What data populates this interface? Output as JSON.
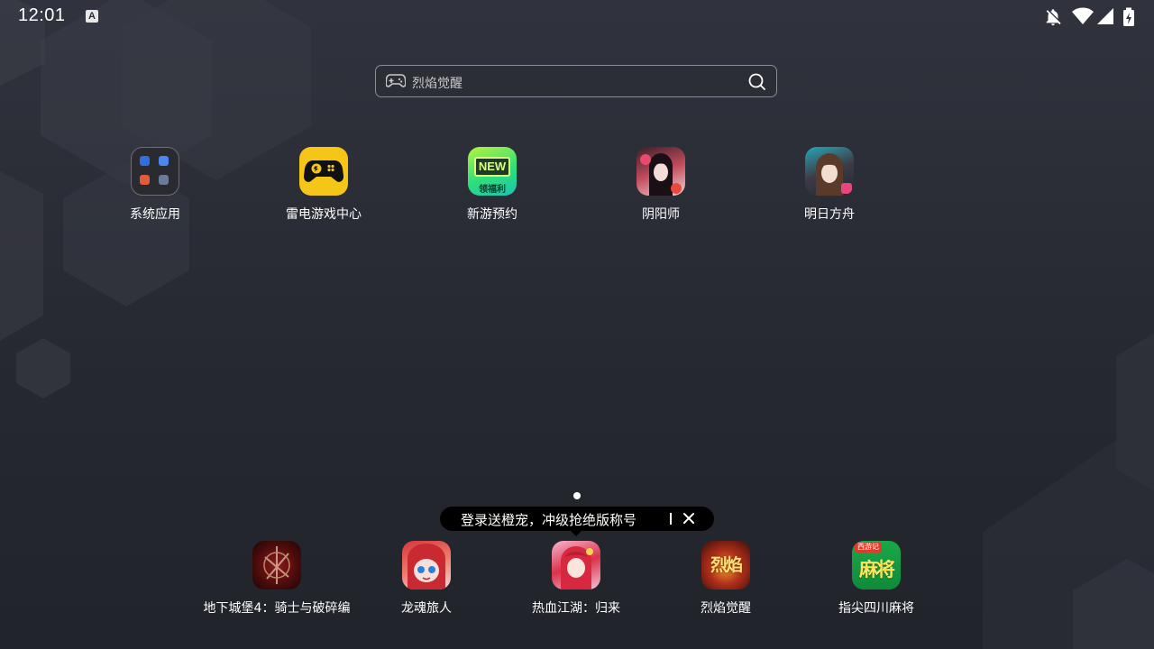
{
  "status_bar": {
    "time": "12:01",
    "notification_badge": "A",
    "icons": [
      "notifications-off-icon",
      "wifi-icon",
      "cell-signal-icon",
      "battery-charging-icon"
    ]
  },
  "search": {
    "hint": "烈焰觉醒",
    "left_icon": "gamepad-icon",
    "right_icon": "search-icon"
  },
  "apps": [
    {
      "label": "系统应用",
      "icon": "folder-icon"
    },
    {
      "label": "雷电游戏中心",
      "icon": "gamepad-icon"
    },
    {
      "label": "新游预约",
      "icon": "new-games-icon",
      "badge_top": "NEW",
      "badge_bottom": "领福利"
    },
    {
      "label": "阴阳师",
      "icon": "onmyoji-icon"
    },
    {
      "label": "明日方舟",
      "icon": "arknights-icon"
    }
  ],
  "page_indicator": {
    "current": 1,
    "total": 1
  },
  "promo": {
    "text": "登录送橙宠，冲级抢绝版称号",
    "close_icon": "close-icon"
  },
  "dock": [
    {
      "label": "地下城堡4：骑士与破碎编",
      "icon": "dungeon-castle-icon"
    },
    {
      "label": "龙魂旅人",
      "icon": "dragon-soul-icon"
    },
    {
      "label": "热血江湖：归来",
      "icon": "rexue-jianghu-icon"
    },
    {
      "label": "烈焰觉醒",
      "icon": "lieyan-juexing-icon",
      "icon_text": "烈焰"
    },
    {
      "label": "指尖四川麻将",
      "icon": "sichuan-mahjong-icon",
      "icon_text": "麻将",
      "icon_tag": "西游记"
    }
  ],
  "colors": {
    "background": "#2a2c34",
    "thunder_yellow": "#f5c518",
    "promo_bg": "#000000"
  }
}
